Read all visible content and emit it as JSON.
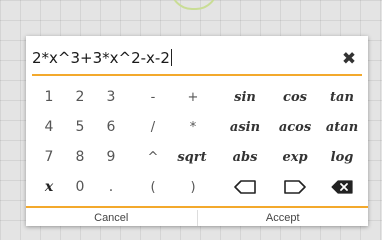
{
  "input": {
    "expression": "2*x^3+3*x^2-x-2"
  },
  "keypad": {
    "row1": [
      "1",
      "2",
      "3",
      "-",
      "+",
      "sin",
      "cos",
      "tan"
    ],
    "row2": [
      "4",
      "5",
      "6",
      "/",
      "*",
      "asin",
      "acos",
      "atan"
    ],
    "row3": [
      "7",
      "8",
      "9",
      "^",
      "sqrt",
      "abs",
      "exp",
      "log"
    ],
    "row4": [
      "x",
      "0",
      ".",
      "(",
      ")"
    ]
  },
  "icons": {
    "clear": "close-icon",
    "cursor_left": "cursor-left-icon",
    "cursor_right": "cursor-right-icon",
    "backspace": "backspace-icon"
  },
  "actions": {
    "cancel": "Cancel",
    "accept": "Accept"
  },
  "colors": {
    "accent": "#f3a92c",
    "dialog_bg": "#ffffff"
  }
}
